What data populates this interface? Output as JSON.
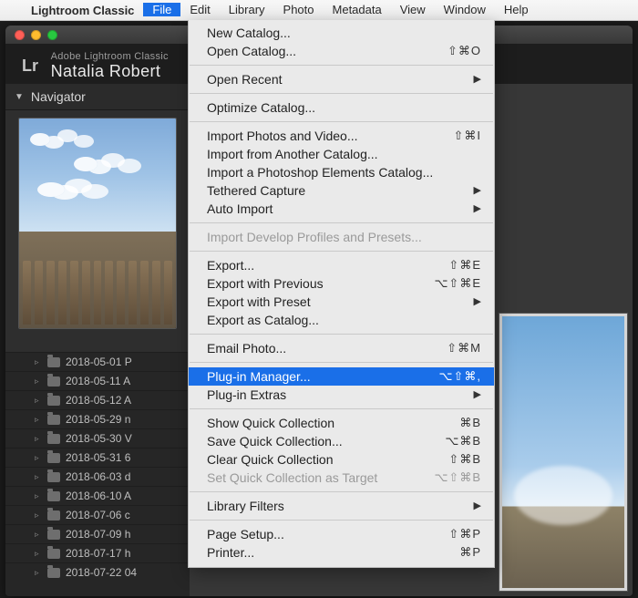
{
  "menubar": {
    "app": "Lightroom Classic",
    "items": [
      "File",
      "Edit",
      "Library",
      "Photo",
      "Metadata",
      "View",
      "Window",
      "Help"
    ],
    "active_index": 0
  },
  "dropdown": {
    "groups": [
      [
        {
          "label": "New Catalog..."
        },
        {
          "label": "Open Catalog...",
          "shortcut": "⇧⌘O"
        }
      ],
      [
        {
          "label": "Open Recent",
          "submenu": true
        }
      ],
      [
        {
          "label": "Optimize Catalog..."
        }
      ],
      [
        {
          "label": "Import Photos and Video...",
          "shortcut": "⇧⌘I"
        },
        {
          "label": "Import from Another Catalog..."
        },
        {
          "label": "Import a Photoshop Elements Catalog..."
        },
        {
          "label": "Tethered Capture",
          "submenu": true
        },
        {
          "label": "Auto Import",
          "submenu": true
        }
      ],
      [
        {
          "label": "Import Develop Profiles and Presets...",
          "disabled": true
        }
      ],
      [
        {
          "label": "Export...",
          "shortcut": "⇧⌘E"
        },
        {
          "label": "Export with Previous",
          "shortcut": "⌥⇧⌘E"
        },
        {
          "label": "Export with Preset",
          "submenu": true
        },
        {
          "label": "Export as Catalog..."
        }
      ],
      [
        {
          "label": "Email Photo...",
          "shortcut": "⇧⌘M"
        }
      ],
      [
        {
          "label": "Plug-in Manager...",
          "shortcut": "⌥⇧⌘,",
          "highlight": true
        },
        {
          "label": "Plug-in Extras",
          "submenu": true
        }
      ],
      [
        {
          "label": "Show Quick Collection",
          "shortcut": "⌘B"
        },
        {
          "label": "Save Quick Collection...",
          "shortcut": "⌥⌘B"
        },
        {
          "label": "Clear Quick Collection",
          "shortcut": "⇧⌘B"
        },
        {
          "label": "Set Quick Collection as Target",
          "shortcut": "⌥⇧⌘B",
          "disabled": true
        }
      ],
      [
        {
          "label": "Library Filters",
          "submenu": true
        }
      ],
      [
        {
          "label": "Page Setup...",
          "shortcut": "⇧⌘P"
        },
        {
          "label": "Printer...",
          "shortcut": "⌘P"
        }
      ]
    ]
  },
  "identity": {
    "small": "Adobe Lightroom Classic",
    "big": "Natalia Robert",
    "logo": "Lr"
  },
  "navigator": {
    "title": "Navigator"
  },
  "folders": [
    "2018-05-01 P",
    "2018-05-11 A",
    "2018-05-12 A",
    "2018-05-29 n",
    "2018-05-30 V",
    "2018-05-31 6",
    "2018-06-03 d",
    "2018-06-10 A",
    "2018-07-06 c",
    "2018-07-09 h",
    "2018-07-17 h",
    "2018-07-22 04"
  ]
}
